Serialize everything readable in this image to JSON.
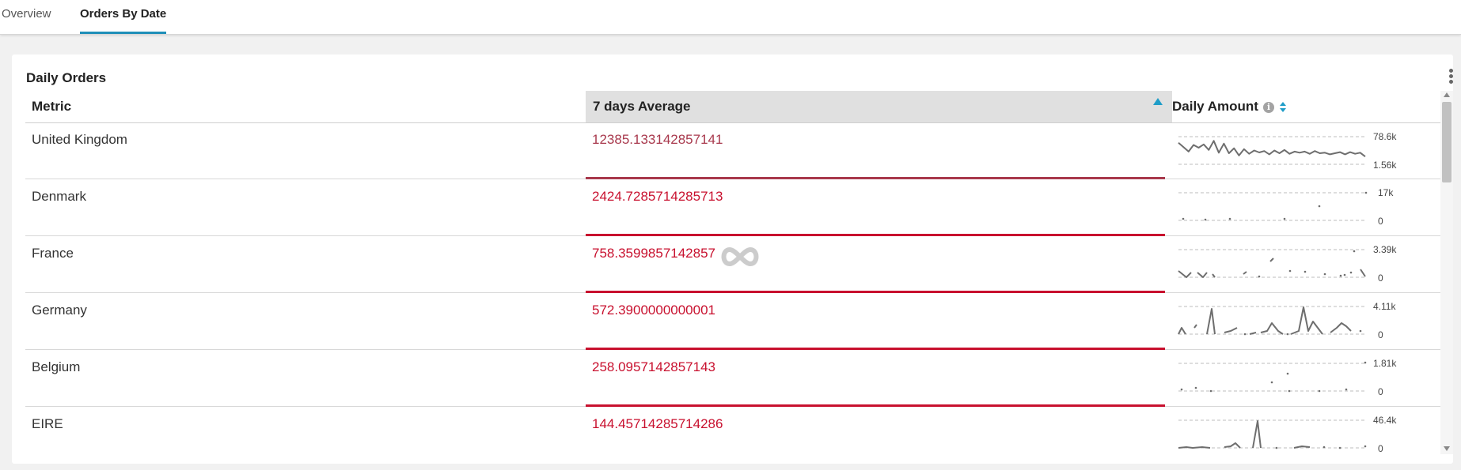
{
  "tabs": [
    {
      "label": "Overview",
      "active": false
    },
    {
      "label": "Orders By Date",
      "active": true
    }
  ],
  "card": {
    "title": "Daily Orders",
    "columns": [
      "Metric",
      "7 days Average",
      "Daily Amount"
    ],
    "info_icon": "info-icon",
    "sort": {
      "column": "7 days Average",
      "direction": "ascending"
    },
    "rows": [
      {
        "metric": "United Kingdom",
        "avg": "12385.133142857141",
        "max_label": "78.6k",
        "min_label": "1.56k",
        "spark": [
          78,
          62,
          46,
          70,
          60,
          72,
          52,
          85,
          42,
          75,
          40,
          58,
          32,
          55,
          38,
          50,
          43,
          48,
          36,
          50,
          40,
          52,
          38,
          46,
          42,
          46,
          38,
          48,
          40,
          42,
          36,
          40,
          44,
          36,
          44,
          38,
          42,
          28
        ]
      },
      {
        "metric": "Denmark",
        "avg": "2424.7285714285713",
        "max_label": "17k",
        "min_label": "0"
      },
      {
        "metric": "France",
        "avg": "758.3599857142857",
        "max_label": "3.39k",
        "min_label": "0"
      },
      {
        "metric": "Germany",
        "avg": "572.3900000000001",
        "max_label": "4.11k",
        "min_label": "0"
      },
      {
        "metric": "Belgium",
        "avg": "258.0957142857143",
        "max_label": "1.81k",
        "min_label": "0"
      },
      {
        "metric": "EIRE",
        "avg": "144.45714285714286",
        "max_label": "46.4k",
        "min_label": "0"
      }
    ]
  },
  "colors": {
    "accent": "#1f9dc8",
    "value_red": "#c8102e",
    "spark": "#6e6e6e"
  }
}
